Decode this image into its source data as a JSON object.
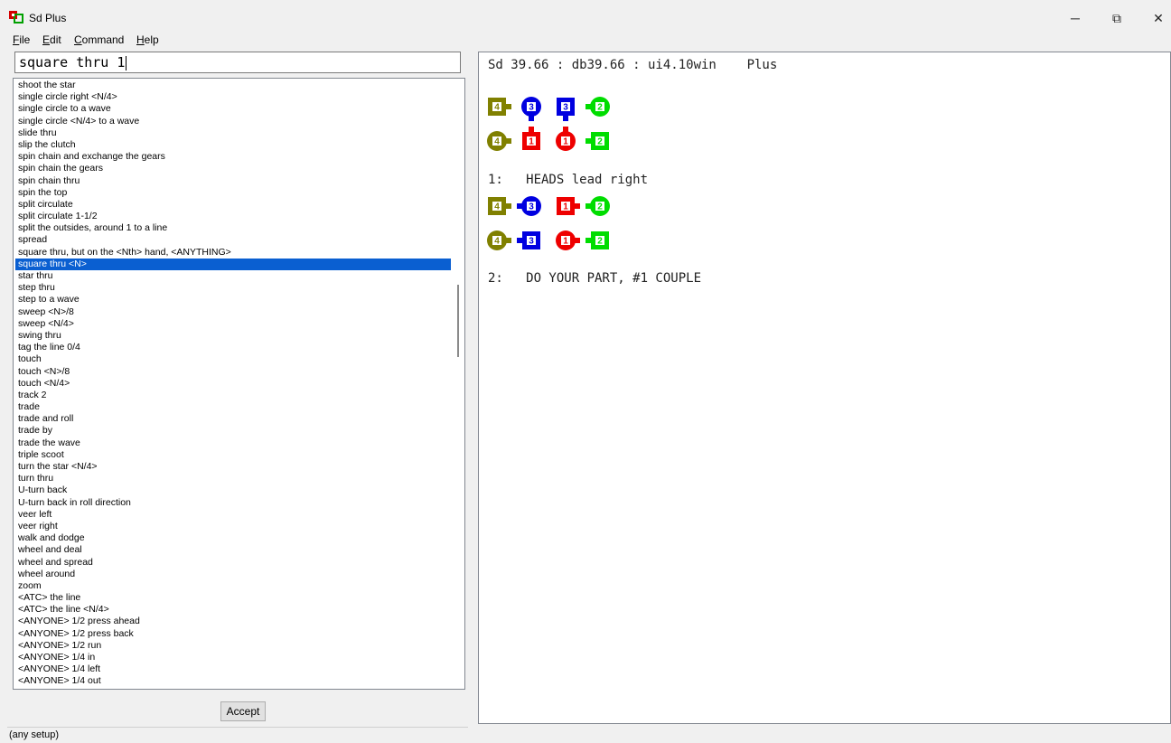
{
  "window": {
    "title": "Sd Plus",
    "minimize_glyph": "─",
    "restore_glyph": "⧉",
    "close_glyph": "✕"
  },
  "menu": {
    "file": {
      "accel": "F",
      "rest": "ile"
    },
    "edit": {
      "accel": "E",
      "rest": "dit"
    },
    "command": {
      "accel": "C",
      "rest": "ommand"
    },
    "help": {
      "accel": "H",
      "rest": "elp"
    }
  },
  "input": {
    "value": "square thru 1"
  },
  "list": {
    "items": [
      "shoot the star",
      "single circle right <N/4>",
      "single circle to a wave",
      "single circle <N/4> to a wave",
      "slide thru",
      "slip the clutch",
      "spin chain and exchange the gears",
      "spin chain the gears",
      "spin chain thru",
      "spin the top",
      "split circulate",
      "split circulate 1-1/2",
      "split the outsides, around 1 to a line",
      "spread",
      "square thru, but on the <Nth> hand, <ANYTHING>",
      "square thru <N>",
      "star thru",
      "step thru",
      "step to a wave",
      "sweep <N>/8",
      "sweep <N/4>",
      "swing thru",
      "tag the line 0/4",
      "touch",
      "touch <N>/8",
      "touch <N/4>",
      "track 2",
      "trade",
      "trade and roll",
      "trade by",
      "trade the wave",
      "triple scoot",
      "turn the star <N/4>",
      "turn thru",
      "U-turn back",
      "U-turn back in roll direction",
      "veer left",
      "veer right",
      "walk and dodge",
      "wheel and deal",
      "wheel and spread",
      "wheel around",
      "zoom",
      "<ATC> the line",
      "<ATC> the line <N/4>",
      "<ANYONE> 1/2 press ahead",
      "<ANYONE> 1/2 press back",
      "<ANYONE> 1/2 run",
      "<ANYONE> 1/4 in",
      "<ANYONE> 1/4 left",
      "<ANYONE> 1/4 out"
    ],
    "selected_index": 15
  },
  "accept_label": "Accept",
  "status_text": "(any setup)",
  "output": {
    "header": "Sd 39.66 : db39.66 : ui4.10win    Plus",
    "line1": "1:   HEADS lead right",
    "line2": "2:   DO YOUR PART, #1 COUPLE"
  },
  "colors": {
    "couple4": "#808000",
    "couple3": "#0000e0",
    "couple1": "#ee0000",
    "couple2": "#00dd00",
    "selection": "#0a5fd1"
  },
  "formations": [
    [
      [
        {
          "n": "4",
          "c": "couple4",
          "s": "square",
          "d": "right"
        },
        {
          "n": "3",
          "c": "couple3",
          "s": "circle",
          "d": "down"
        },
        {
          "n": "3",
          "c": "couple3",
          "s": "square",
          "d": "down"
        },
        {
          "n": "2",
          "c": "couple2",
          "s": "circle",
          "d": "left"
        }
      ],
      [
        {
          "n": "4",
          "c": "couple4",
          "s": "circle",
          "d": "right"
        },
        {
          "n": "1",
          "c": "couple1",
          "s": "square",
          "d": "up"
        },
        {
          "n": "1",
          "c": "couple1",
          "s": "circle",
          "d": "up"
        },
        {
          "n": "2",
          "c": "couple2",
          "s": "square",
          "d": "left"
        }
      ]
    ],
    [
      [
        {
          "n": "4",
          "c": "couple4",
          "s": "square",
          "d": "right"
        },
        {
          "n": "3",
          "c": "couple3",
          "s": "circle",
          "d": "left"
        },
        {
          "n": "1",
          "c": "couple1",
          "s": "square",
          "d": "right"
        },
        {
          "n": "2",
          "c": "couple2",
          "s": "circle",
          "d": "left"
        }
      ],
      [
        {
          "n": "4",
          "c": "couple4",
          "s": "circle",
          "d": "right"
        },
        {
          "n": "3",
          "c": "couple3",
          "s": "square",
          "d": "left"
        },
        {
          "n": "1",
          "c": "couple1",
          "s": "circle",
          "d": "right"
        },
        {
          "n": "2",
          "c": "couple2",
          "s": "square",
          "d": "left"
        }
      ]
    ]
  ]
}
